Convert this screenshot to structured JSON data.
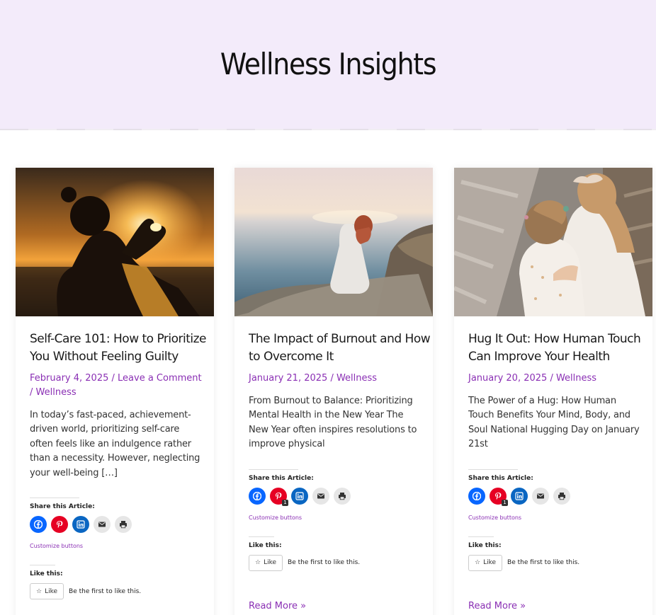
{
  "page": {
    "title": "Wellness Insights"
  },
  "posts": [
    {
      "title": "Self-Care 101: How to Prioritize You Without Feeling Guilty",
      "date": "February 4, 2025",
      "comment_link": "Leave a Comment",
      "category": "Wellness",
      "excerpt": "In today’s fast-paced, achievement-driven world, prioritizing self-care often feels like an indulgence rather than a necessity. However, neglecting your well-being […]",
      "pinterest_count": "",
      "read_more": ""
    },
    {
      "title": "The Impact of Burnout and How to Overcome It",
      "date": "January 21, 2025",
      "comment_link": "",
      "category": "Wellness",
      "excerpt": "From Burnout to Balance: Prioritizing Mental Health in the New Year The New Year often inspires resolutions to improve physical",
      "pinterest_count": "1",
      "read_more": "Read More »"
    },
    {
      "title": "Hug It Out: How Human Touch Can Improve Your Health",
      "date": "January 20, 2025",
      "comment_link": "",
      "category": "Wellness",
      "excerpt": "The Power of a Hug: How Human Touch Benefits Your Mind, Body, and Soul National Hugging Day on January 21st",
      "pinterest_count": "1",
      "read_more": "Read More »"
    }
  ],
  "share": {
    "heading": "Share this Article:",
    "customize": "Customize buttons",
    "icons": [
      "facebook-icon",
      "pinterest-icon",
      "linkedin-icon",
      "email-icon",
      "print-icon"
    ]
  },
  "like": {
    "heading": "Like this:",
    "button": "Like",
    "text": "Be the first to like this."
  },
  "colors": {
    "accent": "#8a2fb4",
    "hero_bg": "#f3ebfa",
    "facebook": "#0866ff",
    "pinterest": "#e60023",
    "linkedin": "#0a66c2"
  }
}
